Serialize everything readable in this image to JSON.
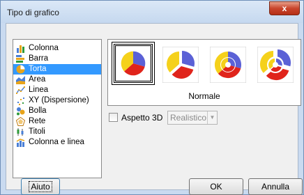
{
  "window": {
    "title": "Tipo di grafico",
    "close_label": "x"
  },
  "chart_types": [
    {
      "label": "Colonna",
      "icon": "column-chart-icon"
    },
    {
      "label": "Barra",
      "icon": "bar-chart-icon"
    },
    {
      "label": "Torta",
      "icon": "pie-chart-icon",
      "selected": true
    },
    {
      "label": "Area",
      "icon": "area-chart-icon"
    },
    {
      "label": "Linea",
      "icon": "line-chart-icon"
    },
    {
      "label": "XY (Dispersione)",
      "icon": "scatter-chart-icon"
    },
    {
      "label": "Bolla",
      "icon": "bubble-chart-icon"
    },
    {
      "label": "Rete",
      "icon": "net-chart-icon"
    },
    {
      "label": "Titoli",
      "icon": "stock-chart-icon"
    },
    {
      "label": "Colonna e linea",
      "icon": "column-line-chart-icon"
    }
  ],
  "variants": {
    "selected_label": "Normale",
    "items": [
      "normal-pie",
      "exploded-pie",
      "donut",
      "exploded-donut"
    ],
    "colors": {
      "blue": "#5b61d6",
      "yellow": "#f5d11b",
      "red": "#e0241b"
    }
  },
  "aspect3d": {
    "label": "Aspetto 3D",
    "checked": false,
    "combo_value": "Realistico"
  },
  "buttons": {
    "help": "Aiuto",
    "ok": "OK",
    "cancel": "Annulla"
  }
}
